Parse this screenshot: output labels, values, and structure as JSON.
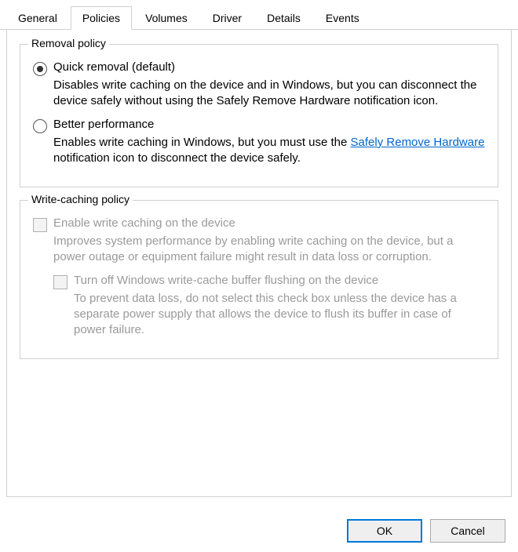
{
  "tabs": {
    "general": "General",
    "policies": "Policies",
    "volumes": "Volumes",
    "driver": "Driver",
    "details": "Details",
    "events": "Events"
  },
  "removalPolicy": {
    "legend": "Removal policy",
    "quickRemoval": {
      "label": "Quick removal (default)",
      "description": "Disables write caching on the device and in Windows, but you can disconnect the device safely without using the Safely Remove Hardware notification icon."
    },
    "betterPerformance": {
      "label": "Better performance",
      "descPrefix": "Enables write caching in Windows, but you must use the ",
      "linkText": "Safely Remove Hardware",
      "descSuffix": " notification icon to disconnect the device safely."
    }
  },
  "writeCachingPolicy": {
    "legend": "Write-caching policy",
    "enableCaching": {
      "label": "Enable write caching on the device",
      "description": "Improves system performance by enabling write caching on the device, but a power outage or equipment failure might result in data loss or corruption."
    },
    "turnOffFlushing": {
      "label": "Turn off Windows write-cache buffer flushing on the device",
      "description": "To prevent data loss, do not select this check box unless the device has a separate power supply that allows the device to flush its buffer in case of power failure."
    }
  },
  "buttons": {
    "ok": "OK",
    "cancel": "Cancel"
  }
}
